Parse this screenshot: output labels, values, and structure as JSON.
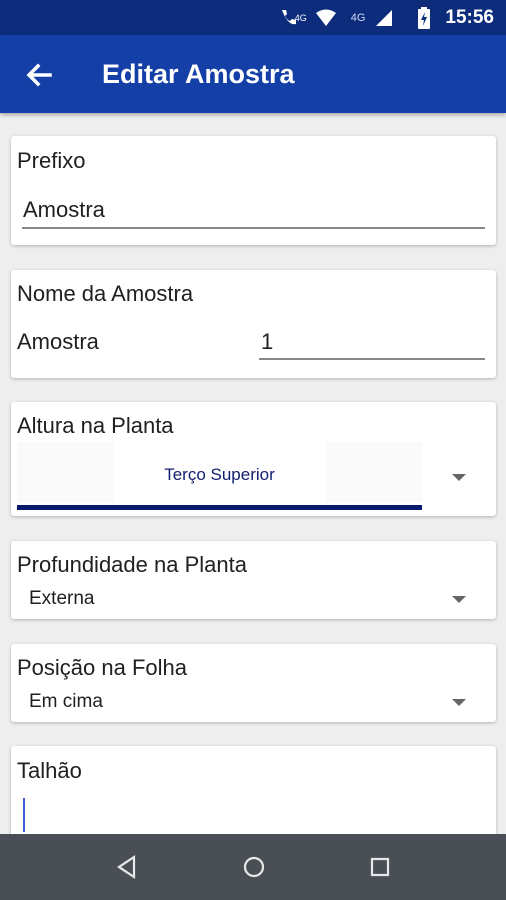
{
  "status_bar": {
    "time": "15:56",
    "network_label_1": "4G",
    "network_label_2": "4G",
    "icons": [
      "call-icon",
      "wifi-icon",
      "signal-icon",
      "battery-charging-icon"
    ]
  },
  "toolbar": {
    "title": "Editar Amostra",
    "back_icon": "arrow-back-icon"
  },
  "form": {
    "prefixo": {
      "label": "Prefixo",
      "value": "Amostra"
    },
    "nome": {
      "label": "Nome da Amostra",
      "prefix_text": "Amostra",
      "number": "1"
    },
    "altura": {
      "label": "Altura na Planta",
      "selected": "Terço Superior"
    },
    "profundidade": {
      "label": "Profundidade na Planta",
      "selected": "Externa"
    },
    "posicao": {
      "label": "Posição na Folha",
      "selected": "Em cima"
    },
    "talhao": {
      "label": "Talhão",
      "value": ""
    }
  },
  "nav_bar": {
    "buttons": [
      "back-triangle-icon",
      "home-circle-icon",
      "recents-square-icon"
    ]
  },
  "colors": {
    "status_bar": "#0d2d7c",
    "toolbar": "#133fa7",
    "accent_line": "#0a1a6e"
  }
}
